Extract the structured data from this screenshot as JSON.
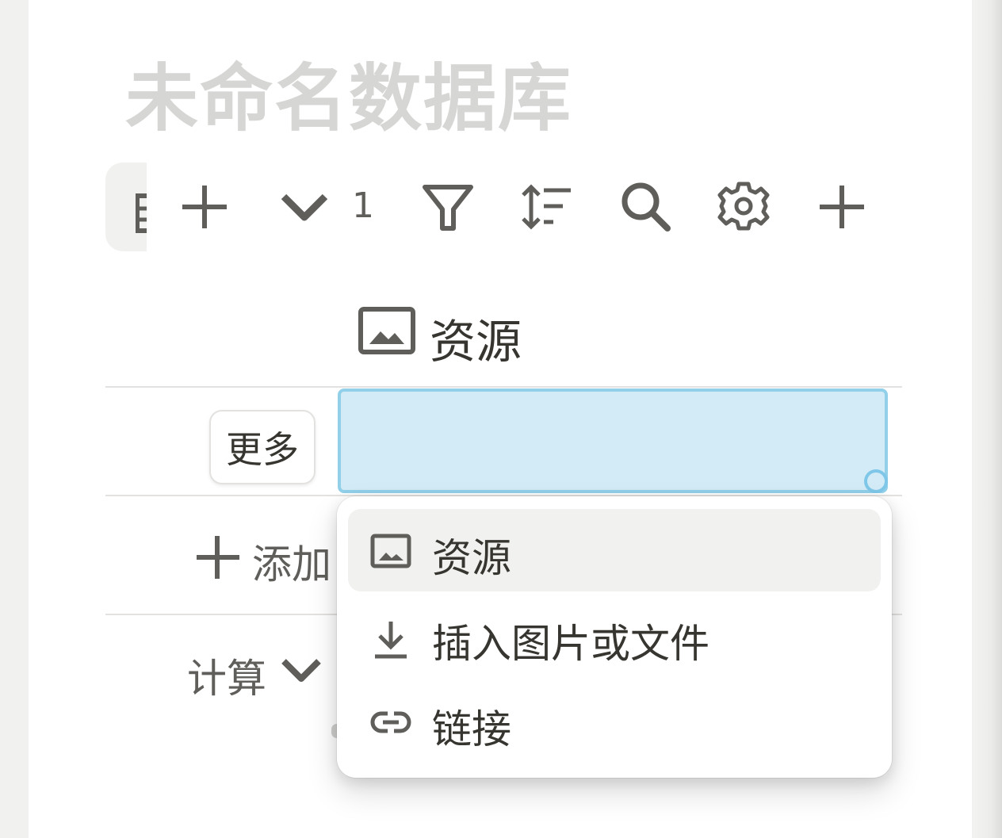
{
  "database": {
    "title": "未命名数据库"
  },
  "toolbar": {
    "filter_count": "1",
    "icons": [
      "add-view-icon",
      "chevron-down-icon",
      "filter-icon",
      "sort-icon",
      "search-icon",
      "gear-icon",
      "new-icon"
    ]
  },
  "table": {
    "column_header": "资源",
    "row_more_label": "更多",
    "add_row_label": "添加",
    "calc_label": "计算"
  },
  "menu": {
    "items": [
      {
        "label": "资源",
        "icon": "image-icon",
        "active": true
      },
      {
        "label": "插入图片或文件",
        "icon": "download-icon",
        "active": false
      },
      {
        "label": "链接",
        "icon": "link-icon",
        "active": false
      }
    ]
  },
  "colors": {
    "selection_fill": "#d3ebf6",
    "selection_border": "#92d0ea",
    "text": "#37352f",
    "muted_text": "#5f5e5b",
    "title_placeholder": "#d6d6d4"
  }
}
